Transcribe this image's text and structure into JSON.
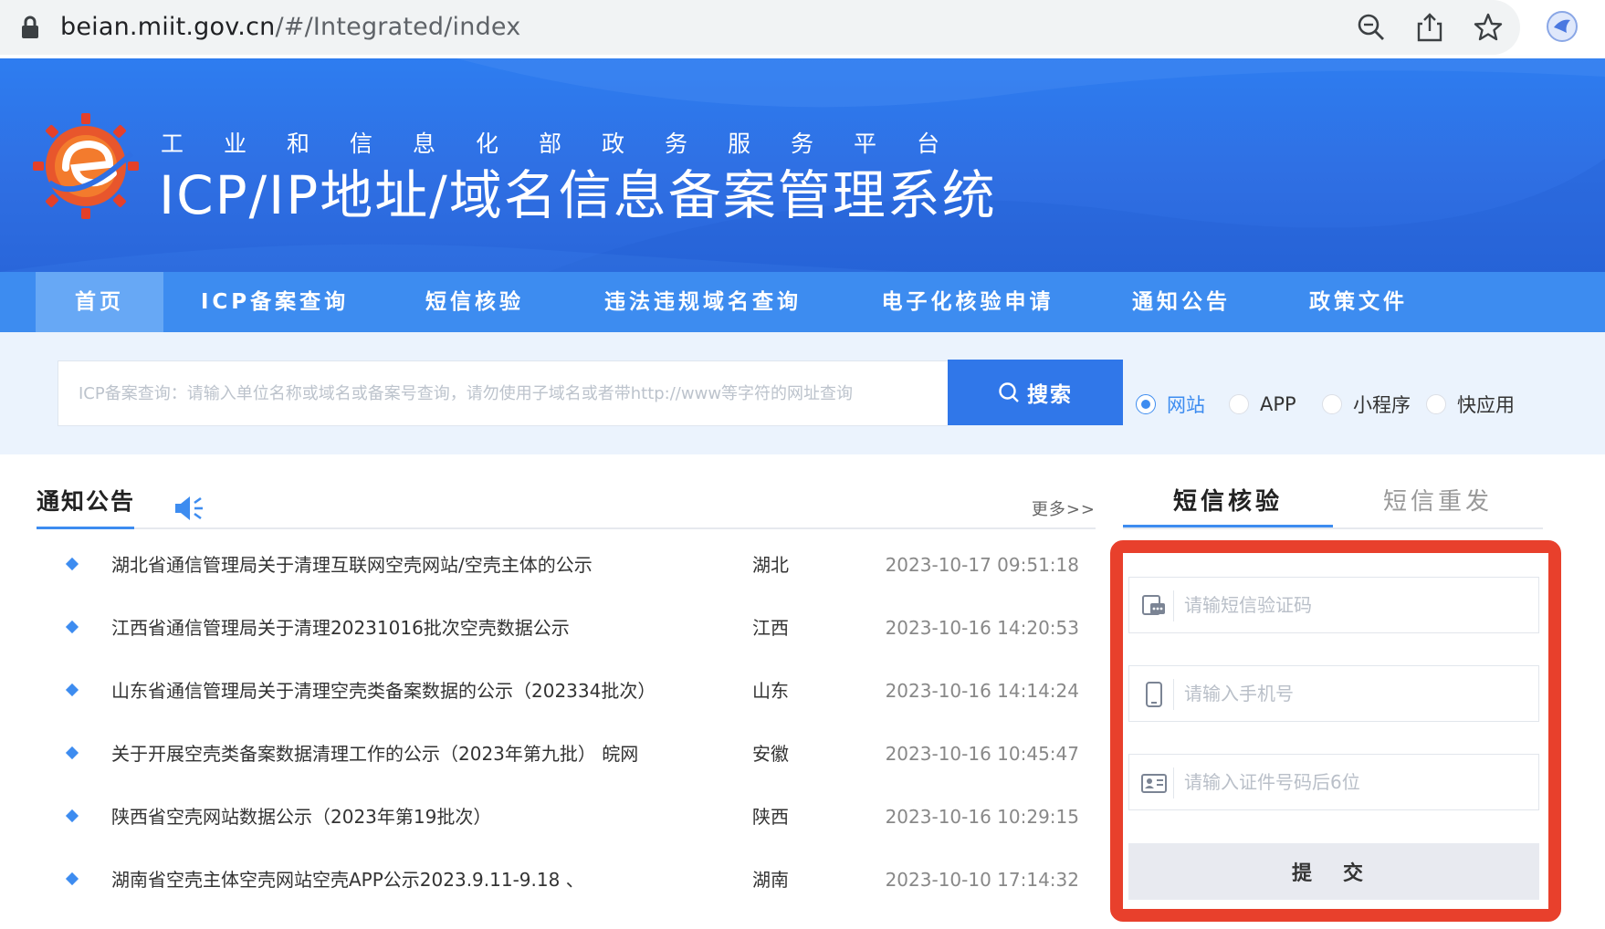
{
  "browser": {
    "url_domain": "beian.miit.gov.cn",
    "url_path": "/#/Integrated/index",
    "icons": [
      "lock-icon",
      "zoom-icon",
      "share-icon",
      "star-icon",
      "extension-icon"
    ]
  },
  "header": {
    "subtitle": "工业和信息化部政务服务平台",
    "title": "ICP/IP地址/域名信息备案管理系统",
    "logo": "miit-gear-logo"
  },
  "nav": {
    "items": [
      {
        "label": "首页",
        "active": true
      },
      {
        "label": "ICP备案查询",
        "active": false
      },
      {
        "label": "短信核验",
        "active": false
      },
      {
        "label": "违法违规域名查询",
        "active": false
      },
      {
        "label": "电子化核验申请",
        "active": false
      },
      {
        "label": "通知公告",
        "active": false
      },
      {
        "label": "政策文件",
        "active": false
      }
    ]
  },
  "search": {
    "placeholder": "ICP备案查询：请输入单位名称或域名或备案号查询，请勿使用子域名或者带http://www等字符的网址查询",
    "button_label": "搜索",
    "options": [
      {
        "label": "网站",
        "checked": true
      },
      {
        "label": "APP",
        "checked": false
      },
      {
        "label": "小程序",
        "checked": false
      },
      {
        "label": "快应用",
        "checked": false
      }
    ]
  },
  "notices": {
    "title": "通知公告",
    "more_label": "更多>>",
    "rows": [
      {
        "title": "湖北省通信管理局关于清理互联网空壳网站/空壳主体的公示",
        "region": "湖北",
        "time": "2023-10-17 09:51:18"
      },
      {
        "title": "江西省通信管理局关于清理20231016批次空壳数据公示",
        "region": "江西",
        "time": "2023-10-16 14:20:53"
      },
      {
        "title": "山东省通信管理局关于清理空壳类备案数据的公示（202334批次）",
        "region": "山东",
        "time": "2023-10-16 14:14:24"
      },
      {
        "title": "关于开展空壳类备案数据清理工作的公示（2023年第九批） 皖网",
        "region": "安徽",
        "time": "2023-10-16 10:45:47"
      },
      {
        "title": "陕西省空壳网站数据公示（2023年第19批次）",
        "region": "陕西",
        "time": "2023-10-16 10:29:15"
      },
      {
        "title": "湖南省空壳主体空壳网站空壳APP公示2023.9.11-9.18 、",
        "region": "湖南",
        "time": "2023-10-10 17:14:32"
      }
    ]
  },
  "sms": {
    "tabs": [
      {
        "label": "短信核验",
        "active": true
      },
      {
        "label": "短信重发",
        "active": false
      }
    ],
    "code_placeholder": "请输短信验证码",
    "phone_placeholder": "请输入手机号",
    "id_placeholder": "请输入证件号码后6位",
    "submit_label": "提 交",
    "highlight_color": "#e8402c"
  },
  "colors": {
    "primary": "#3d8cf0",
    "banner": "#2f6fe3",
    "search_button": "#3077e9"
  }
}
